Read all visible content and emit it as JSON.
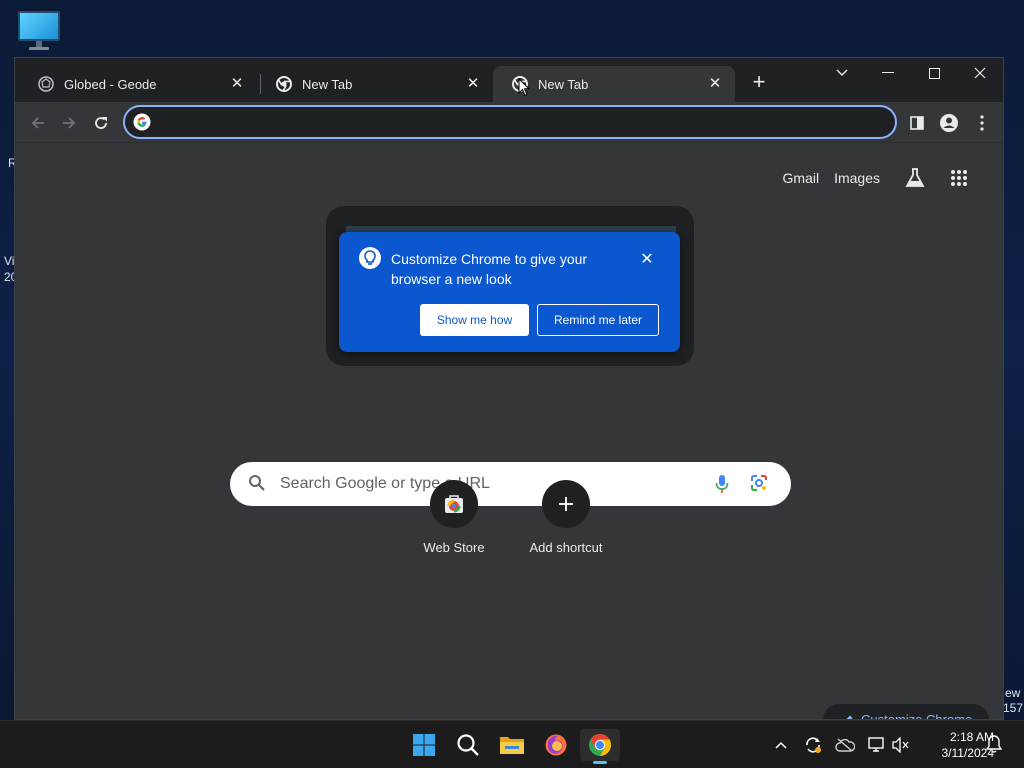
{
  "desktop": {
    "fragments": [
      "R",
      "Vi",
      "20",
      "ew",
      "157"
    ]
  },
  "browser": {
    "tabs": [
      {
        "title": "Globed - Geode",
        "favicon": "geode-icon"
      },
      {
        "title": "New Tab",
        "favicon": "chrome-icon"
      },
      {
        "title": "New Tab",
        "favicon": "chrome-icon",
        "active": true
      }
    ],
    "address_bar": {
      "value": "",
      "placeholder": ""
    },
    "top_links": {
      "gmail": "Gmail",
      "images": "Images"
    },
    "promo": {
      "text": "Customize Chrome to give your browser a new look",
      "primary": "Show me how",
      "secondary": "Remind me later"
    },
    "search": {
      "placeholder": "Search Google or type a URL"
    },
    "shortcuts": [
      {
        "label": "Web Store",
        "icon": "web-store-icon"
      },
      {
        "label": "Add shortcut",
        "icon": "plus-icon"
      }
    ],
    "customize_label": "Customize Chrome"
  },
  "taskbar": {
    "apps": [
      "start-icon",
      "search-icon",
      "file-explorer-icon",
      "firefox-icon",
      "chrome-icon"
    ],
    "clock": {
      "time": "2:18 AM",
      "date": "3/11/2024"
    }
  },
  "colors": {
    "accent": "#8ab4f8",
    "promo_bg": "#0b57d0",
    "window_bg": "#35363a",
    "tabstrip_bg": "#202124"
  }
}
